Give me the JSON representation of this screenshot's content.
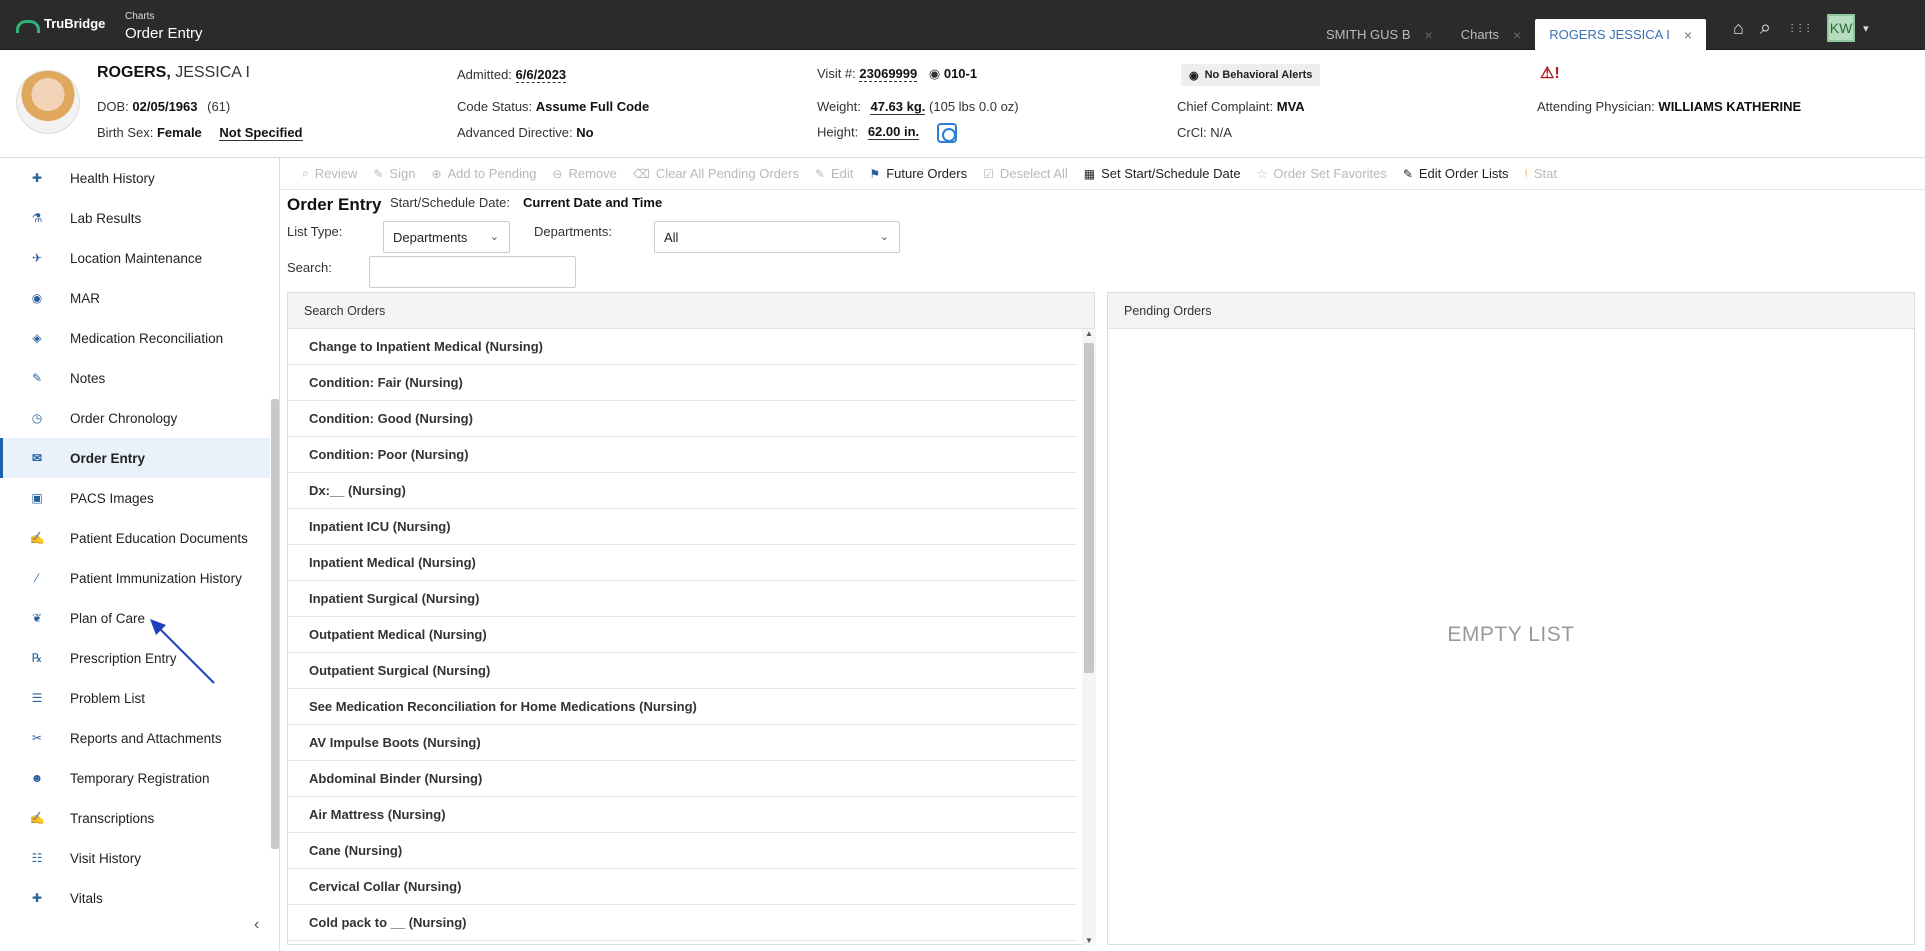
{
  "app": {
    "brand": "TruBridge",
    "crumb_small": "Charts",
    "crumb_title": "Order Entry"
  },
  "tabs": [
    {
      "label": "SMITH GUS B",
      "close": "×"
    },
    {
      "label": "Charts",
      "close": "×"
    },
    {
      "label": "ROGERS JESSICA I",
      "close": "×"
    }
  ],
  "top_icons": {
    "home": "⌂",
    "search": "⌕",
    "apps": "⋮⋮⋮",
    "user_initials": "KW",
    "caret": "▾"
  },
  "patient": {
    "last_name": "ROGERS,",
    "first_name": "JESSICA I",
    "dob_label": "DOB:",
    "dob": "02/05/1963",
    "age": "(61)",
    "sex_label": "Birth Sex:",
    "sex": "Female",
    "sex_extra": "Not Specified",
    "admitted_label": "Admitted:",
    "admitted": "6/6/2023",
    "code_label": "Code Status:",
    "code": "Assume Full Code",
    "directive_label": "Advanced Directive:",
    "directive": "No",
    "visit_label": "Visit #:",
    "visit": "23069999",
    "room": "010-1",
    "weight_label": "Weight:",
    "weight": "47.63 kg.",
    "weight_alt": "(105 lbs 0.0 oz)",
    "height_label": "Height:",
    "height": "62.00 in.",
    "behavioral_alert": "No Behavioral Alerts",
    "complaint_label": "Chief Complaint:",
    "complaint": "MVA",
    "crcl_label": "CrCl:",
    "crcl": "N/A",
    "warning_glyph": "⚠!",
    "physician_label": "Attending Physician:",
    "physician": "WILLIAMS KATHERINE"
  },
  "sidebar": {
    "items": [
      {
        "label": "Health History",
        "icon": "✚"
      },
      {
        "label": "Lab Results",
        "icon": "⚗"
      },
      {
        "label": "Location Maintenance",
        "icon": "✈"
      },
      {
        "label": "MAR",
        "icon": "◉"
      },
      {
        "label": "Medication Reconciliation",
        "icon": "◈"
      },
      {
        "label": "Notes",
        "icon": "✎"
      },
      {
        "label": "Order Chronology",
        "icon": "◷"
      },
      {
        "label": "Order Entry",
        "icon": "✉"
      },
      {
        "label": "PACS Images",
        "icon": "▣"
      },
      {
        "label": "Patient Education Documents",
        "icon": "✍"
      },
      {
        "label": "Patient Immunization History",
        "icon": "⁄"
      },
      {
        "label": "Plan of Care",
        "icon": "❦"
      },
      {
        "label": "Prescription Entry",
        "icon": "℞"
      },
      {
        "label": "Problem List",
        "icon": "☰"
      },
      {
        "label": "Reports and Attachments",
        "icon": "✂"
      },
      {
        "label": "Temporary Registration",
        "icon": "☻"
      },
      {
        "label": "Transcriptions",
        "icon": "✍"
      },
      {
        "label": "Visit History",
        "icon": "☷"
      },
      {
        "label": "Vitals",
        "icon": "✚"
      }
    ],
    "collapse": "‹"
  },
  "toolbar": [
    {
      "label": "Review",
      "icon": "⌕"
    },
    {
      "label": "Sign",
      "icon": "✎"
    },
    {
      "label": "Add to Pending",
      "icon": "⊕"
    },
    {
      "label": "Remove",
      "icon": "⊖"
    },
    {
      "label": "Clear All Pending Orders",
      "icon": "⌫"
    },
    {
      "label": "Edit",
      "icon": "✎"
    },
    {
      "label": "Future Orders",
      "icon": "⚑"
    },
    {
      "label": "Deselect All",
      "icon": "☑"
    },
    {
      "label": "Set Start/Schedule Date",
      "icon": "▦"
    },
    {
      "label": "Order Set Favorites",
      "icon": "☆"
    },
    {
      "label": "Edit Order Lists",
      "icon": "✎"
    },
    {
      "label": "Stat",
      "icon": "!"
    }
  ],
  "form": {
    "title": "Order Entry",
    "start_label": "Start/Schedule Date:",
    "start_value": "Current Date and Time",
    "list_type_label": "List Type:",
    "list_type_value": "Departments",
    "departments_label": "Departments:",
    "departments_value": "All",
    "search_label": "Search:",
    "chevron": "⌄"
  },
  "search_panel": {
    "title": "Search Orders",
    "orders": [
      "Change to Inpatient Medical (Nursing)",
      "Condition: Fair (Nursing)",
      "Condition: Good (Nursing)",
      "Condition: Poor (Nursing)",
      "Dx:__ (Nursing)",
      "Inpatient ICU (Nursing)",
      "Inpatient Medical (Nursing)",
      "Inpatient Surgical (Nursing)",
      "Outpatient Medical (Nursing)",
      "Outpatient Surgical (Nursing)",
      "See Medication Reconciliation for Home Medications (Nursing)",
      "AV Impulse Boots (Nursing)",
      "Abdominal Binder (Nursing)",
      "Air Mattress (Nursing)",
      "Cane (Nursing)",
      "Cervical Collar (Nursing)",
      "Cold pack to __ (Nursing)"
    ],
    "scroll_up": "▲",
    "scroll_down": "▼"
  },
  "pending_panel": {
    "title": "Pending Orders",
    "empty_text": "EMPTY LIST"
  },
  "colors": {
    "topbar": "#2b2b2b",
    "accent": "#1f5fad",
    "active_bg": "#e9f1fb",
    "brand_green": "#31b37a"
  }
}
